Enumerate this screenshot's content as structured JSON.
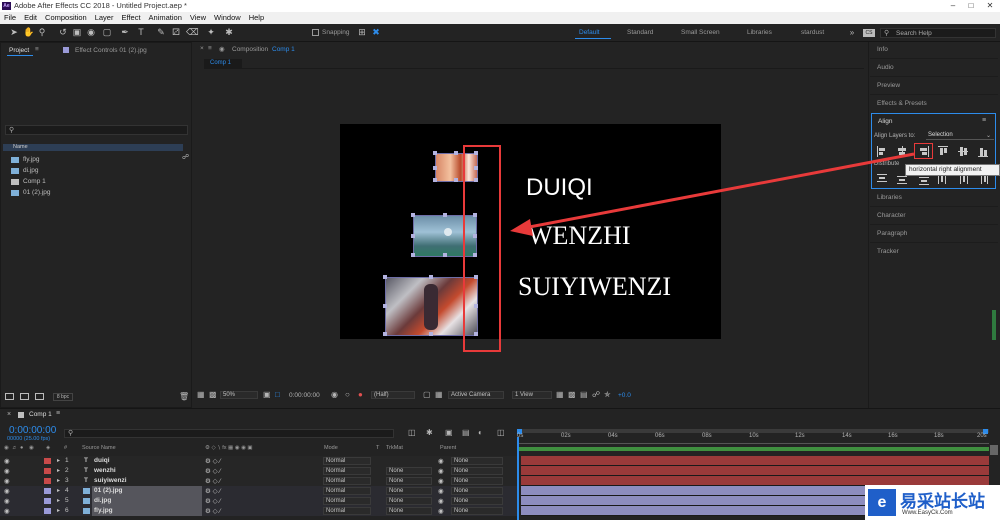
{
  "window": {
    "title": "Adobe After Effects CC 2018 - Untitled Project.aep *",
    "app_badge": "Ae"
  },
  "menu": [
    "File",
    "Edit",
    "Composition",
    "Layer",
    "Effect",
    "Animation",
    "View",
    "Window",
    "Help"
  ],
  "toolbar": {
    "snapping_label": "Snapping",
    "workspaces": [
      "Default",
      "Standard",
      "Small Screen",
      "Libraries",
      "stardust"
    ],
    "search_placeholder": "Search Help"
  },
  "project_panel": {
    "tab_project": "Project",
    "tab_effect_controls": "Effect Controls 01 (2).jpg",
    "name_header": "Name",
    "items": [
      "fly.jpg",
      "di.jpg",
      "Comp 1",
      "01 (2).jpg"
    ],
    "bpc": "8 bpc"
  },
  "comp_panel": {
    "tab_label": "Composition",
    "tab_comp": "Comp 1",
    "sub_tab": "Comp 1",
    "texts": [
      "DUIQI",
      "WENZHI",
      "SUIYIWENZI"
    ],
    "zoom": "50%",
    "timecode": "0:00:00:00",
    "resolution": "(Half)",
    "camera": "Active Camera",
    "view": "1 View",
    "exposure": "+0.0"
  },
  "right_panel": {
    "items_top": [
      "Info",
      "Audio",
      "Preview",
      "Effects & Presets"
    ],
    "align_title": "Align",
    "align_to_label": "Align Layers to:",
    "align_to_value": "Selection",
    "distribute_label": "Distribute",
    "tooltip": "horizontal right alignment",
    "items_bottom": [
      "Libraries",
      "Character",
      "Paragraph",
      "Tracker"
    ]
  },
  "timeline": {
    "tab": "Comp 1",
    "timecode": "0:00:00:00",
    "fps": "00000 (25.00 fps)",
    "headers": {
      "source": "Source Name",
      "mode": "Mode",
      "t": "T",
      "trkmat": "TrkMat",
      "parent": "Parent"
    },
    "ruler": [
      "0s",
      "02s",
      "04s",
      "06s",
      "08s",
      "10s",
      "12s",
      "14s",
      "16s",
      "18s",
      "20s"
    ],
    "layers": [
      {
        "num": "1",
        "type": "T",
        "name": "duiqi",
        "mode": "Normal",
        "trkmat": "",
        "parent": "None",
        "color": "#c84a4a"
      },
      {
        "num": "2",
        "type": "T",
        "name": "wenzhi",
        "mode": "Normal",
        "trkmat": "None",
        "parent": "None",
        "color": "#c84a4a"
      },
      {
        "num": "3",
        "type": "T",
        "name": "suiyiwenzi",
        "mode": "Normal",
        "trkmat": "None",
        "parent": "None",
        "color": "#c84a4a"
      },
      {
        "num": "4",
        "type": "img",
        "name": "01 (2).jpg",
        "mode": "Normal",
        "trkmat": "None",
        "parent": "None",
        "color": "#9a9ad8"
      },
      {
        "num": "5",
        "type": "img",
        "name": "di.jpg",
        "mode": "Normal",
        "trkmat": "None",
        "parent": "None",
        "color": "#9a9ad8"
      },
      {
        "num": "6",
        "type": "img",
        "name": "fly.jpg",
        "mode": "Normal",
        "trkmat": "None",
        "parent": "None",
        "color": "#9a9ad8"
      }
    ]
  },
  "watermark": {
    "text_cn": "易采站长站",
    "text_en": "Www.EasyCk.Com"
  },
  "colors": {
    "accent_blue": "#2d8ceb",
    "annotation_red": "#e83a3a",
    "text_bar": "#9a3a3a",
    "image_bar": "#8d8dbf"
  }
}
